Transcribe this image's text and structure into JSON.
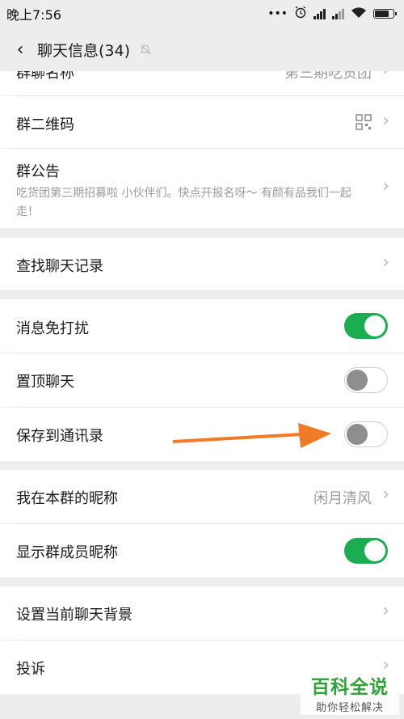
{
  "status_bar": {
    "time": "晚上7:56",
    "dots": "•••"
  },
  "nav": {
    "back_glyph": "‹",
    "title": "聊天信息(34)"
  },
  "rows": {
    "group_name_partial": "群聊名称",
    "group_name_value_partial": "第三期吃货团",
    "qr_code": "群二维码",
    "notice": "群公告",
    "notice_text": "吃货团第三期招募啦 小伙伴们。快点开报名呀～ 有颜有品我们一起走！",
    "search_history": "查找聊天记录",
    "mute": "消息免打扰",
    "pin": "置顶聊天",
    "save_contacts": "保存到通讯录",
    "my_nickname": "我在本群的昵称",
    "my_nickname_value": "闲月清风",
    "show_member_nicknames": "显示群成员昵称",
    "set_background": "设置当前聊天背景",
    "complain": "投诉",
    "chevron": "›"
  },
  "toggles": {
    "mute": true,
    "pin": false,
    "save_contacts": false,
    "show_member_nicknames": true
  },
  "colors": {
    "accent_green": "#1aad52",
    "arrow_orange": "#f07a26",
    "watermark_green": "#2fa336"
  },
  "watermark": {
    "title": "百科全说",
    "subtitle": "助你轻松解决"
  }
}
